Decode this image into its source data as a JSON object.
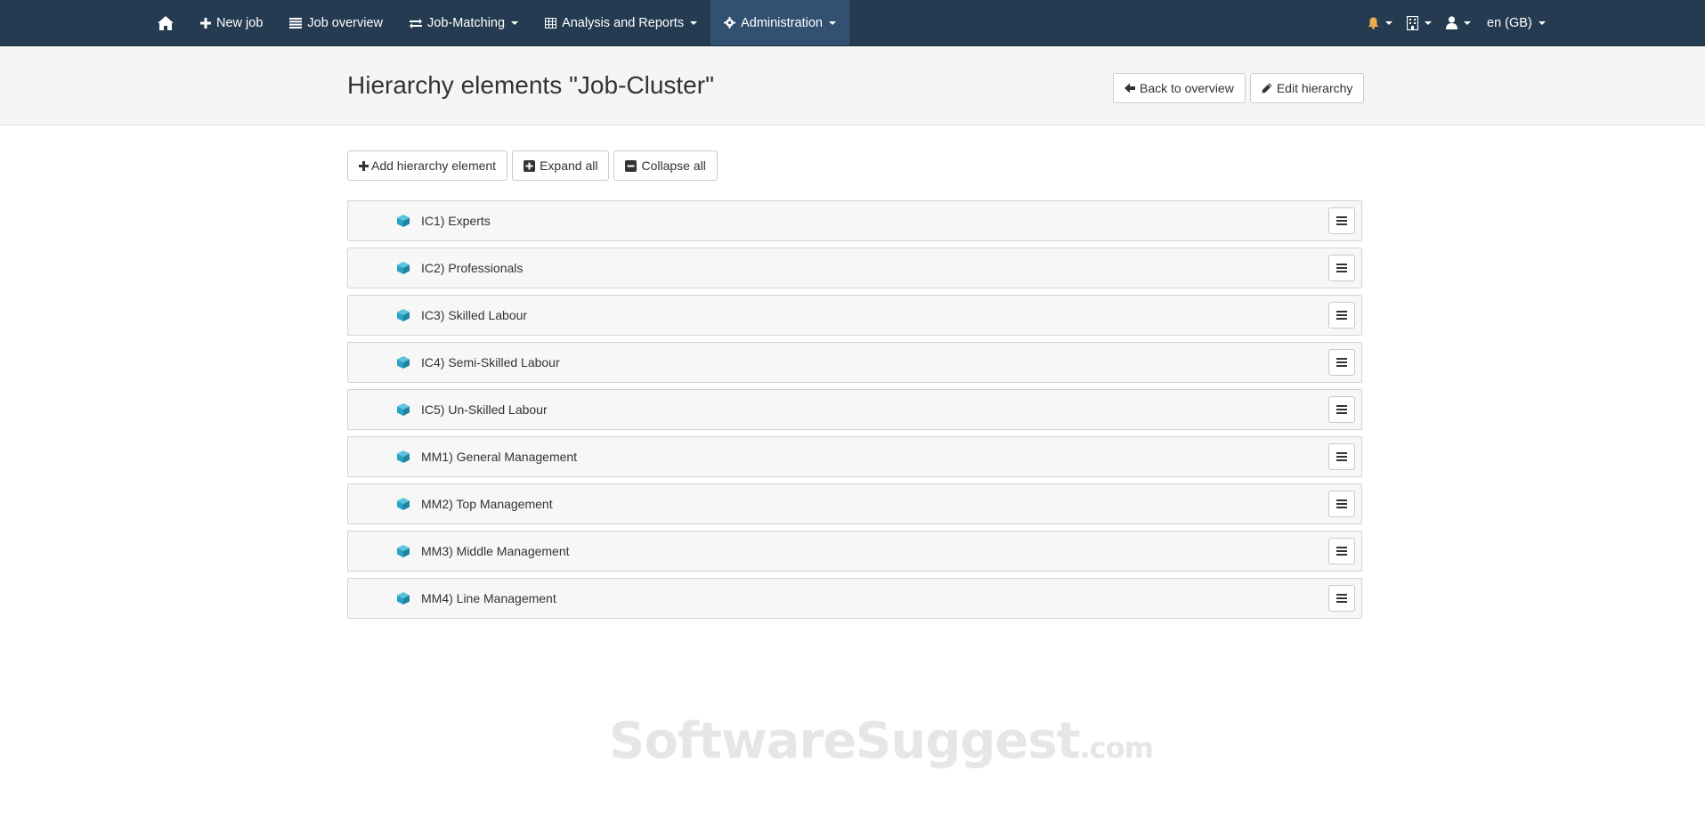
{
  "navbar": {
    "items": [
      {
        "label": "New job",
        "icon": "plus-icon"
      },
      {
        "label": "Job overview",
        "icon": "list-icon"
      },
      {
        "label": "Job-Matching",
        "icon": "exchange-icon",
        "dropdown": true
      },
      {
        "label": "Analysis and Reports",
        "icon": "table-icon",
        "dropdown": true
      },
      {
        "label": "Administration",
        "icon": "gear-icon",
        "dropdown": true,
        "active": true
      }
    ],
    "language": "en (GB)",
    "bell_color": "#f0ad4e",
    "background": "#253b52"
  },
  "header": {
    "title": "Hierarchy elements \"Job-Cluster\"",
    "back_label": "Back to overview",
    "edit_label": "Edit hierarchy"
  },
  "toolbar": {
    "add_label": "Add hierarchy element",
    "expand_label": "Expand all",
    "collapse_label": "Collapse all"
  },
  "elements": [
    "IC1) Experts",
    "IC2) Professionals",
    "IC3) Skilled Labour",
    "IC4) Semi-Skilled Labour",
    "IC5) Un-Skilled Labour",
    "MM1) General Management",
    "MM2) Top Management",
    "MM3) Middle Management",
    "MM4) Line Management"
  ],
  "cube_color": "#2aa3c2",
  "watermark": {
    "main": "SoftwareSuggest",
    "suffix": ".com"
  }
}
